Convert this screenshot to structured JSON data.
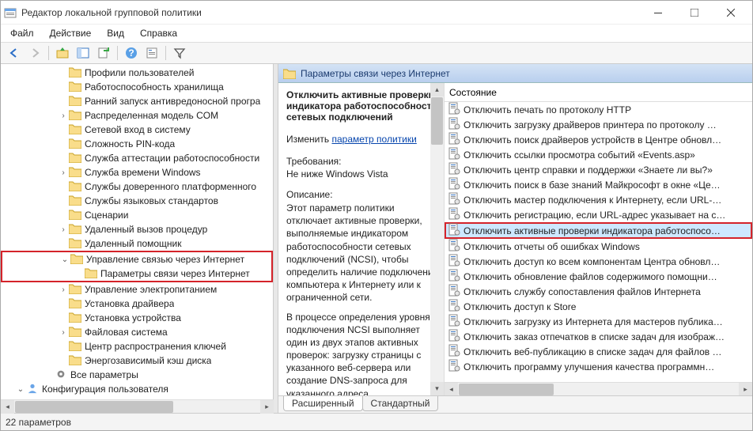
{
  "window": {
    "title": "Редактор локальной групповой политики"
  },
  "menu": {
    "file": "Файл",
    "action": "Действие",
    "view": "Вид",
    "help": "Справка"
  },
  "tree": {
    "items": [
      {
        "indent": 72,
        "exp": "",
        "label": "Профили пользователей"
      },
      {
        "indent": 72,
        "exp": "",
        "label": "Работоспособность хранилища"
      },
      {
        "indent": 72,
        "exp": "",
        "label": "Ранний запуск антивредоносной програ"
      },
      {
        "indent": 72,
        "exp": ">",
        "label": "Распределенная модель COM"
      },
      {
        "indent": 72,
        "exp": "",
        "label": "Сетевой вход в систему"
      },
      {
        "indent": 72,
        "exp": "",
        "label": "Сложность PIN-кода"
      },
      {
        "indent": 72,
        "exp": "",
        "label": "Служба аттестации работоспособности"
      },
      {
        "indent": 72,
        "exp": ">",
        "label": "Служба времени Windows"
      },
      {
        "indent": 72,
        "exp": "",
        "label": "Службы доверенного платформенного"
      },
      {
        "indent": 72,
        "exp": "",
        "label": "Службы языковых стандартов"
      },
      {
        "indent": 72,
        "exp": "",
        "label": "Сценарии"
      },
      {
        "indent": 72,
        "exp": ">",
        "label": "Удаленный вызов процедур"
      },
      {
        "indent": 72,
        "exp": "",
        "label": "Удаленный помощник"
      },
      {
        "indent": 72,
        "exp": "v",
        "label": "Управление связью через Интернет",
        "red": true
      },
      {
        "indent": 90,
        "exp": "",
        "label": "Параметры связи через Интернет",
        "red": true,
        "selected": true
      },
      {
        "indent": 72,
        "exp": ">",
        "label": "Управление электропитанием"
      },
      {
        "indent": 72,
        "exp": "",
        "label": "Установка драйвера"
      },
      {
        "indent": 72,
        "exp": "",
        "label": "Установка устройства"
      },
      {
        "indent": 72,
        "exp": ">",
        "label": "Файловая система"
      },
      {
        "indent": 72,
        "exp": "",
        "label": "Центр распространения ключей"
      },
      {
        "indent": 72,
        "exp": "",
        "label": "Энергозависимый кэш диска"
      },
      {
        "indent": 54,
        "exp": "",
        "label": "Все параметры",
        "icon": "gear"
      },
      {
        "indent": 18,
        "exp": "v",
        "label": "Конфигурация пользователя",
        "icon": "user"
      }
    ]
  },
  "header": {
    "title": "Параметры связи через Интернет"
  },
  "description": {
    "title": "Отключить активные проверки индикатора работоспособности сетевых подключений",
    "edit_label": "Изменить",
    "edit_link": "параметр политики",
    "req_label": "Требования:",
    "req_value": "Не ниже Windows Vista",
    "desc_label": "Описание:",
    "desc_body": "Этот параметр политики отключает активные проверки, выполняемые индикатором работоспособности сетевых подключений (NCSI), чтобы определить наличие подключения компьютера к Интернету или к ограниченной сети.\n\nВ процессе определения уровня подключения NCSI выполняет один из двух этапов активных проверок: загрузку страницы с указанного веб-сервера или создание DNS-запроса для указанного адреса."
  },
  "list": {
    "column": "Состояние",
    "rows": [
      "Отключить печать по протоколу HTTP",
      "Отключить загрузку драйверов принтера по протоколу …",
      "Отключить поиск драйверов устройств в Центре обновл…",
      "Отключить ссылки просмотра событий «Events.asp»",
      "Отключить центр справки и поддержки «Знаете ли вы?»",
      "Отключить поиск в базе знаний Майкрософт в окне «Це…",
      "Отключить мастер подключения к Интернету, если URL-…",
      "Отключить регистрацию, если URL-адрес указывает на с…",
      "Отключить активные проверки индикатора работоспосо…",
      "Отключить отчеты об ошибках Windows",
      "Отключить доступ ко всем компонентам Центра обновл…",
      "Отключить обновление файлов содержимого помощни…",
      "Отключить службу сопоставления файлов Интернета",
      "Отключить доступ к Store",
      "Отключить загрузку из Интернета для мастеров публика…",
      "Отключить заказ отпечатков в списке задач для изображ…",
      "Отключить веб-публикацию в списке задач для файлов …",
      "Отключить программу улучшения качества программн…"
    ],
    "selected_index": 8
  },
  "tabs": {
    "extended": "Расширенный",
    "standard": "Стандартный"
  },
  "status": {
    "text": "22 параметров"
  }
}
